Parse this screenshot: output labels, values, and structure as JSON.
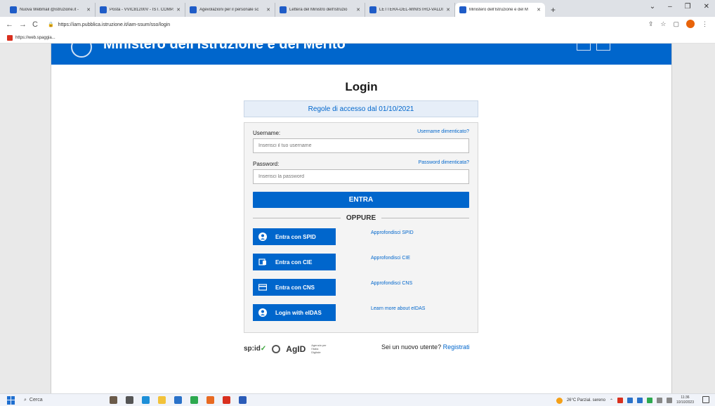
{
  "browser": {
    "tabs": [
      {
        "label": "Nuova Webmail @istruzione.it -"
      },
      {
        "label": "Posta - VVIC81200V - IST. COMP."
      },
      {
        "label": "Agevolazioni per il personale sc"
      },
      {
        "label": "Lettera del Ministro dell'Istruzio"
      },
      {
        "label": "LETTERA-DEL-MINISTRO-VALDI"
      },
      {
        "label": "Ministero dell'Istruzione e del M"
      }
    ],
    "new_tab": "+",
    "url": "https://iam.pubblica.istruzione.it/iam-ssum/sso/login",
    "bookmark": "https://web.spaggia..."
  },
  "header": {
    "ministry_title": "Ministero dell'Istruzione e del Merito"
  },
  "login": {
    "title": "Login",
    "rules": "Regole di accesso dal 01/10/2021",
    "username_label": "Username:",
    "username_forgot": "Username dimenticato?",
    "username_placeholder": "Inserisci il tuo username",
    "password_label": "Password:",
    "password_forgot": "Password dimenticata?",
    "password_placeholder": "Inserisci la password",
    "enter_button": "ENTRA",
    "or_label": "OPPURE",
    "idp": [
      {
        "label": "Entra con SPID",
        "link": "Approfondisci SPID",
        "icon": "user-icon"
      },
      {
        "label": "Entra con CIE",
        "link": "Approfondisci CIE",
        "icon": "id-card-icon"
      },
      {
        "label": "Entra con CNS",
        "link": "Approfondisci CNS",
        "icon": "card-icon"
      },
      {
        "label": "Login with eIDAS",
        "link": "Learn more about eIDAS",
        "icon": "user-icon"
      }
    ]
  },
  "footer": {
    "spid_logo": "sp:id",
    "agid_logo": "AgID",
    "agid_sub": "Agenzia per l'Italia Digitale",
    "new_user_prefix": "Sei un nuovo utente? ",
    "register_link": "Registrati"
  },
  "taskbar": {
    "search": "Cerca",
    "weather": "26°C Parzial. sereno",
    "time": "11:36",
    "date": "10/10/2023"
  },
  "colors": {
    "primary": "#0066cc",
    "rules_bg": "#e6eef8"
  }
}
